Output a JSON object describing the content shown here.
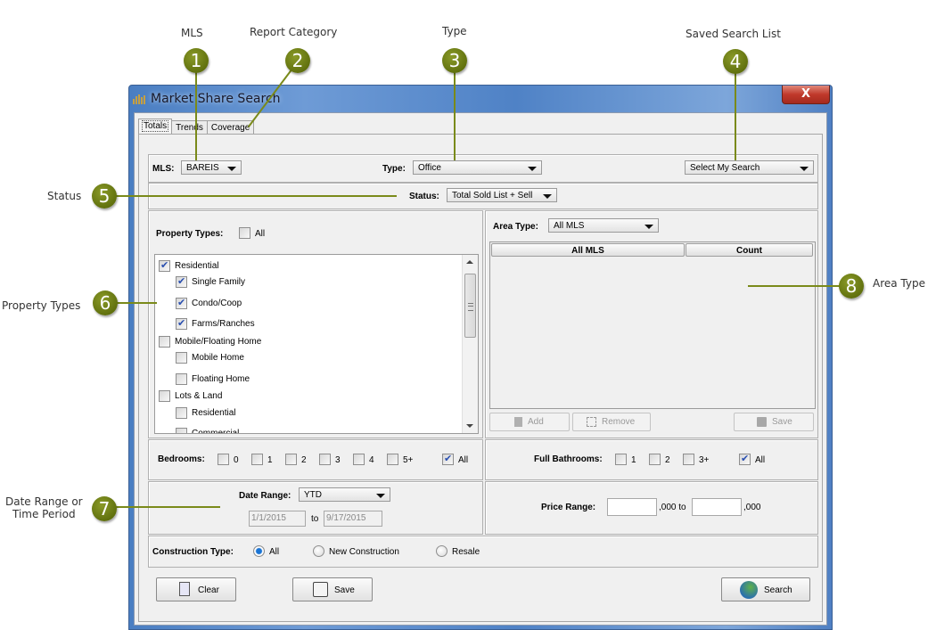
{
  "annotations": [
    {
      "number": "1",
      "label": "MLS"
    },
    {
      "number": "2",
      "label": "Report Category"
    },
    {
      "number": "3",
      "label": "Type"
    },
    {
      "number": "4",
      "label": "Saved Search List"
    },
    {
      "number": "5",
      "label": "Status"
    },
    {
      "number": "6",
      "label": "Property Types"
    },
    {
      "number": "7",
      "label": "Date Range or Time Period"
    },
    {
      "number": "8",
      "label": "Area Type"
    }
  ],
  "annotation_labels": {
    "date_line1": "Date Range or",
    "date_line2": "Time Period"
  },
  "window": {
    "title": "Market Share Search",
    "close_glyph": "X"
  },
  "tabs": [
    {
      "label": "Totals",
      "active": true
    },
    {
      "label": "Trends",
      "active": false
    },
    {
      "label": "Coverage",
      "active": false
    }
  ],
  "top_row": {
    "mls_label": "MLS:",
    "mls_value": "BAREIS",
    "type_label": "Type:",
    "type_value": "Office",
    "saved_search_value": "Select My Search"
  },
  "status": {
    "label": "Status:",
    "value": "Total Sold List + Sell"
  },
  "property_types": {
    "label": "Property Types:",
    "all_label": "All",
    "all_checked": false,
    "items": [
      {
        "label": "Residential",
        "checked": true,
        "level": 0
      },
      {
        "label": "Single Family",
        "checked": true,
        "level": 1
      },
      {
        "label": "Condo/Coop",
        "checked": true,
        "level": 1
      },
      {
        "label": "Farms/Ranches",
        "checked": true,
        "level": 1
      },
      {
        "label": "Mobile/Floating Home",
        "checked": false,
        "level": 0
      },
      {
        "label": "Mobile Home",
        "checked": false,
        "level": 1
      },
      {
        "label": "Floating Home",
        "checked": false,
        "level": 1
      },
      {
        "label": "Lots & Land",
        "checked": false,
        "level": 0
      },
      {
        "label": "Residential",
        "checked": false,
        "level": 1
      },
      {
        "label": "Commercial",
        "checked": false,
        "level": 1
      }
    ]
  },
  "area": {
    "label": "Area Type:",
    "value": "All MLS",
    "columns": [
      "All MLS",
      "Count"
    ],
    "rows": [],
    "add_label": "Add",
    "remove_label": "Remove",
    "save_label": "Save"
  },
  "bedrooms": {
    "label": "Bedrooms:",
    "options": [
      {
        "label": "0",
        "checked": false
      },
      {
        "label": "1",
        "checked": false
      },
      {
        "label": "2",
        "checked": false
      },
      {
        "label": "3",
        "checked": false
      },
      {
        "label": "4",
        "checked": false
      },
      {
        "label": "5+",
        "checked": false
      },
      {
        "label": "All",
        "checked": true
      }
    ]
  },
  "bathrooms": {
    "label": "Full Bathrooms:",
    "options": [
      {
        "label": "1",
        "checked": false
      },
      {
        "label": "2",
        "checked": false
      },
      {
        "label": "3+",
        "checked": false
      },
      {
        "label": "All",
        "checked": true
      }
    ]
  },
  "date_range": {
    "label": "Date Range:",
    "value": "YTD",
    "from": "1/1/2015",
    "to_label": "to",
    "to": "9/17/2015"
  },
  "price_range": {
    "label": "Price Range:",
    "min": "",
    "suffix1": ",000 to",
    "max": "",
    "suffix2": ",000"
  },
  "construction": {
    "label": "Construction Type:",
    "options": [
      {
        "label": "All",
        "selected": true
      },
      {
        "label": "New Construction",
        "selected": false
      },
      {
        "label": "Resale",
        "selected": false
      }
    ]
  },
  "buttons": {
    "clear": "Clear",
    "save": "Save",
    "search": "Search"
  },
  "colors": {
    "annotation_green": "#6b7b14",
    "titlebar_blue": "#5a8ccc",
    "close_red": "#c0392b",
    "check_blue": "#2a4fb0"
  }
}
